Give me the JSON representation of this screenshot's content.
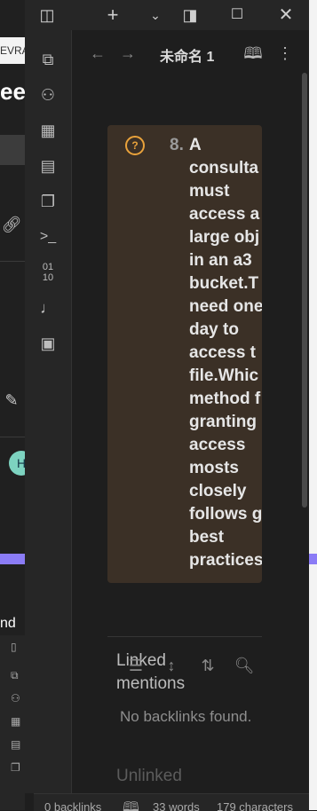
{
  "background_window": {
    "tab_fragment": "EVRA",
    "heading_fragment": "een",
    "avatar_letter": "H",
    "text_fragment": "nd",
    "accent_color": "#8b7cf6"
  },
  "titlebar": {
    "icons": [
      "sidebar-toggle-icon",
      "plus-icon",
      "chevron-down-icon",
      "split-view-icon",
      "maximize-icon",
      "close-icon"
    ]
  },
  "ribbon": {
    "icons": [
      "file-switcher-icon",
      "graph-icon",
      "canvas-icon",
      "calendar-icon",
      "copy-icon",
      "terminal-icon",
      "binary-icon",
      "microphone-icon",
      "layout-icon"
    ]
  },
  "view_header": {
    "title": "未命名 1"
  },
  "callout": {
    "list_number": "8.",
    "text": "A\nconsulta\nmust\naccess a\nlarge obj\nin an a3\nbucket.T\nneed one\nday to\naccess t\nfile.Whic\nmethod f\ngranting\naccess\nmosts\nclosely\nfollows g\nbest\npractices",
    "accent": "#e9a23b",
    "bg": "#3b3026"
  },
  "backlinks": {
    "title": "Linked mentions",
    "empty_text": "No backlinks found.",
    "unlinked_title": "Unlinked"
  },
  "status_bar": {
    "backlinks": "0 backlinks",
    "words": "33 words",
    "characters": "179 characters"
  }
}
